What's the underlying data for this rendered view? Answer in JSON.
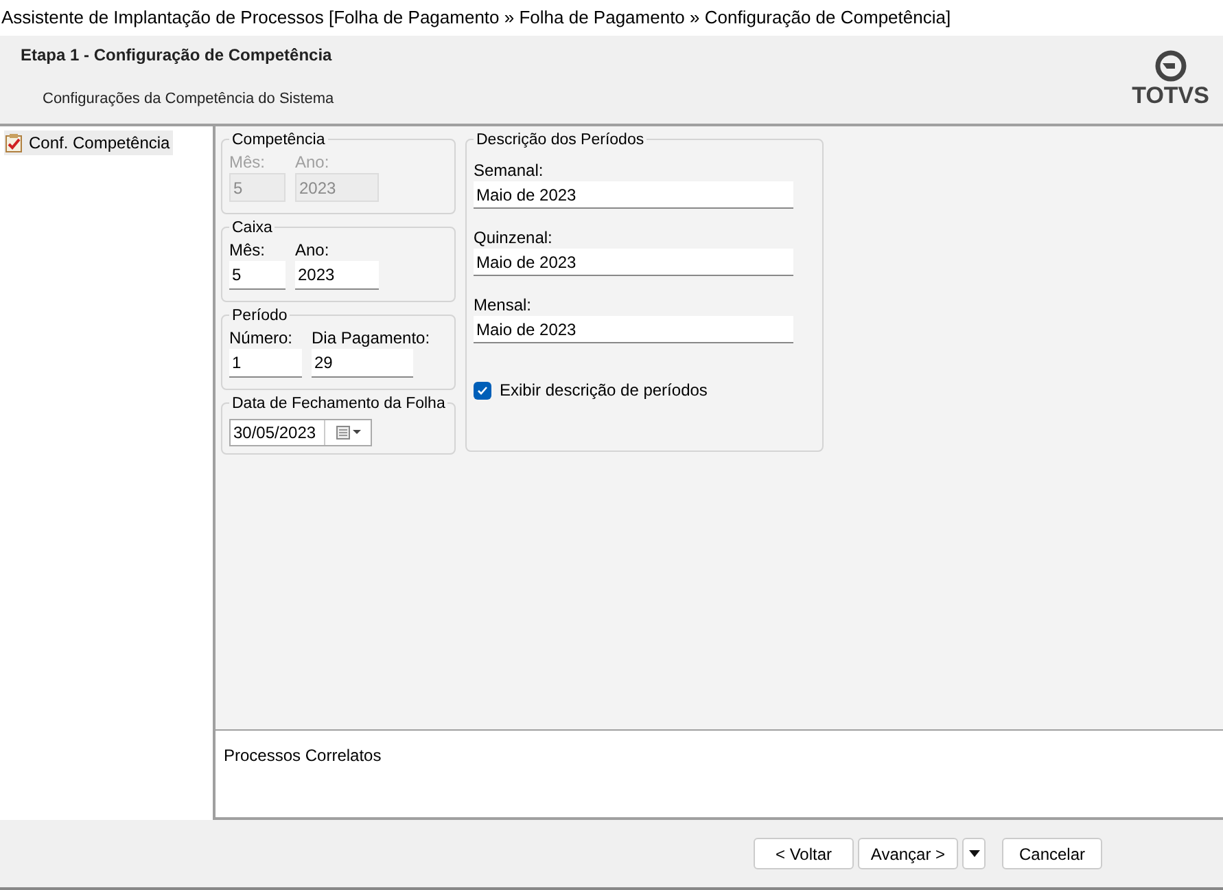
{
  "window": {
    "title": "Assistente de Implantação de Processos [Folha de Pagamento » Folha de Pagamento » Configuração de Competência]"
  },
  "header": {
    "step": "Etapa 1 - Configuração de Competência",
    "subtitle": "Configurações da Competência do Sistema",
    "logo": "TOTVS"
  },
  "sidebar": {
    "items": [
      {
        "label": "Conf. Competência",
        "selected": true
      }
    ]
  },
  "groups": [
    {
      "title": "Competência",
      "fields": [
        {
          "label": "Mês:",
          "value": "5",
          "disabled": true
        },
        {
          "label": "Ano:",
          "value": "2023",
          "disabled": true
        }
      ]
    },
    {
      "title": "Caixa",
      "fields": [
        {
          "label": "Mês:",
          "value": "5",
          "disabled": false
        },
        {
          "label": "Ano:",
          "value": "2023",
          "disabled": false
        }
      ]
    },
    {
      "title": "Período",
      "fields": [
        {
          "label": "Número:",
          "value": "1",
          "disabled": false
        },
        {
          "label": "Dia Pagamento:",
          "value": "29",
          "disabled": false
        }
      ]
    }
  ],
  "closing_date": {
    "title": "Data de Fechamento da Folha",
    "value": "30/05/2023"
  },
  "periods": {
    "title": "Descrição dos Períodos",
    "fields": [
      {
        "label": "Semanal:",
        "value": "Maio de 2023"
      },
      {
        "label": "Quinzenal:",
        "value": "Maio de 2023"
      },
      {
        "label": "Mensal:",
        "value": "Maio de 2023"
      }
    ],
    "checkbox": {
      "label": "Exibir descrição de períodos",
      "checked": true
    }
  },
  "related": {
    "title": "Processos Correlatos"
  },
  "buttons": [
    {
      "label": "< Voltar",
      "kind": "button"
    },
    {
      "label": "Avançar >",
      "kind": "button"
    },
    {
      "kind": "dropdown"
    },
    {
      "label": "Cancelar",
      "kind": "button"
    }
  ]
}
